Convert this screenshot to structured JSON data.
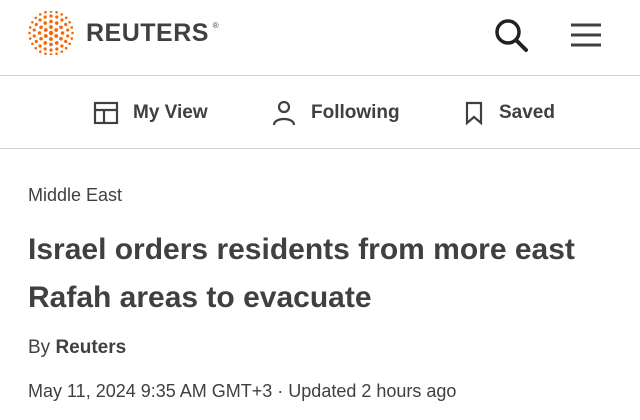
{
  "header": {
    "brand": "REUTERS",
    "registered_mark": "®",
    "logo_icon": "reuters-dots-logo-icon",
    "search_icon": "search-icon",
    "menu_icon": "hamburger-menu-icon",
    "accent_color": "#fa6400"
  },
  "nav": {
    "items": [
      {
        "label": "My View",
        "icon": "layout-icon"
      },
      {
        "label": "Following",
        "icon": "person-icon"
      },
      {
        "label": "Saved",
        "icon": "bookmark-icon"
      }
    ]
  },
  "article": {
    "section": "Middle East",
    "headline": "Israel orders residents from more east Rafah areas to evacuate",
    "byline_prefix": "By ",
    "author": "Reuters",
    "published": "May 11, 2024 9:35 AM GMT+3",
    "separator": " · ",
    "updated": "Updated 2 hours ago"
  }
}
